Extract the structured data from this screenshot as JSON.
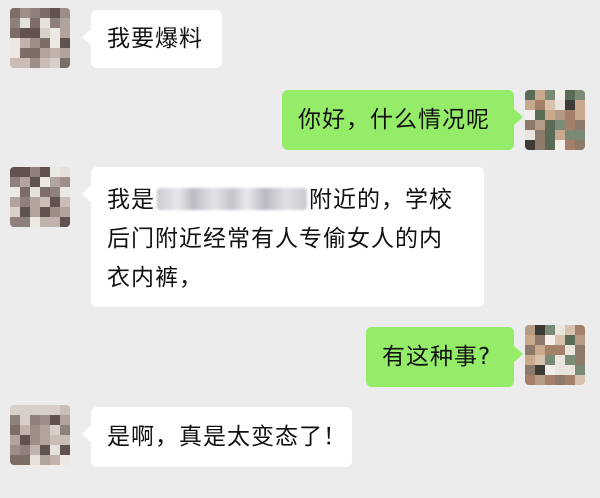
{
  "messages": [
    {
      "side": "left",
      "text": "我要爆料"
    },
    {
      "side": "right",
      "text": "你好，什么情况呢"
    },
    {
      "side": "left",
      "line1_suffix": "附近的，学校",
      "line1_prefix": "我是",
      "line2": "后门附近经常有人专偷女人的内",
      "line3": "衣内裤，",
      "redacted_text": "████████"
    },
    {
      "side": "right",
      "text": "有这种事?"
    },
    {
      "side": "left",
      "text": "是啊，真是太变态了！"
    }
  ],
  "colors": {
    "background": "#ececec",
    "incoming_bubble": "#ffffff",
    "outgoing_bubble": "#95ec69"
  },
  "icons": {
    "contact_avatar": "pixelated-user-avatar",
    "self_avatar": "pixelated-user-avatar"
  }
}
